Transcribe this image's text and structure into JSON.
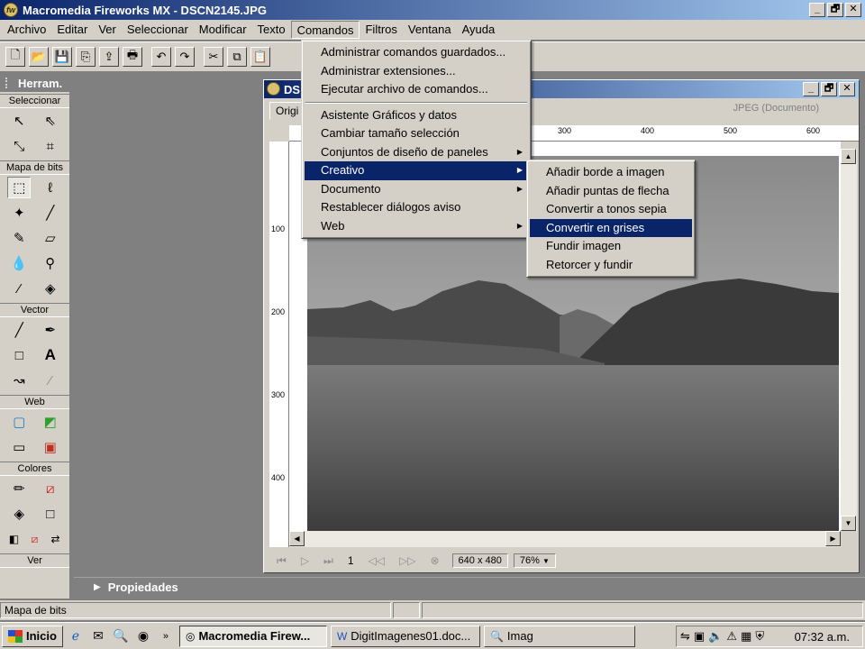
{
  "window": {
    "title": "Macromedia Fireworks MX - DSCN2145.JPG",
    "controls": [
      "_",
      "🗗",
      "✕"
    ]
  },
  "menubar": [
    "Archivo",
    "Editar",
    "Ver",
    "Seleccionar",
    "Modificar",
    "Texto",
    "Comandos",
    "Filtros",
    "Ventana",
    "Ayuda"
  ],
  "tools_panel": {
    "title": "Herram.",
    "sections": {
      "select": "Seleccionar",
      "bitmap": "Mapa de bits",
      "vector": "Vector",
      "web": "Web",
      "colors": "Colores",
      "view": "Ver"
    }
  },
  "document": {
    "title": "DS",
    "tab": "Origi",
    "format": "JPEG (Documento)",
    "ruler_h": [
      "300",
      "400",
      "500",
      "600"
    ],
    "ruler_v": [
      "100",
      "200",
      "300",
      "400"
    ],
    "frame": "1",
    "size": "640 x 480",
    "zoom": "76%"
  },
  "menu_comandos": {
    "group1": [
      "Administrar comandos guardados...",
      "Administrar extensiones...",
      "Ejecutar archivo de comandos..."
    ],
    "group2": [
      {
        "label": "Asistente Gráficos y datos",
        "sub": false
      },
      {
        "label": "Cambiar tamaño selección",
        "sub": false
      },
      {
        "label": "Conjuntos de diseño de paneles",
        "sub": true
      },
      {
        "label": "Creativo",
        "sub": true,
        "highlighted": true
      },
      {
        "label": "Documento",
        "sub": true
      },
      {
        "label": "Restablecer diálogos aviso",
        "sub": false
      },
      {
        "label": "Web",
        "sub": true
      }
    ]
  },
  "menu_creativo": {
    "items": [
      "Añadir borde a imagen",
      "Añadir puntas de flecha",
      "Convertir a tonos sepia",
      "Convertir en grises",
      "Fundir imagen",
      "Retorcer y fundir"
    ],
    "highlighted_index": 3
  },
  "properties_panel": {
    "title": "Propiedades"
  },
  "statusbar": {
    "text": "Mapa de bits"
  },
  "taskbar": {
    "start": "Inicio",
    "tasks": [
      {
        "label": "Macromedia Firew...",
        "active": true
      },
      {
        "label": "DigitImagenes01.doc...",
        "active": false
      },
      {
        "label": "Imag",
        "active": false
      }
    ],
    "clock": "07:32 a.m."
  },
  "colors": {
    "titlebar": "#0a246a",
    "menu_highlight": "#0a246a",
    "chrome": "#d4d0c8"
  }
}
